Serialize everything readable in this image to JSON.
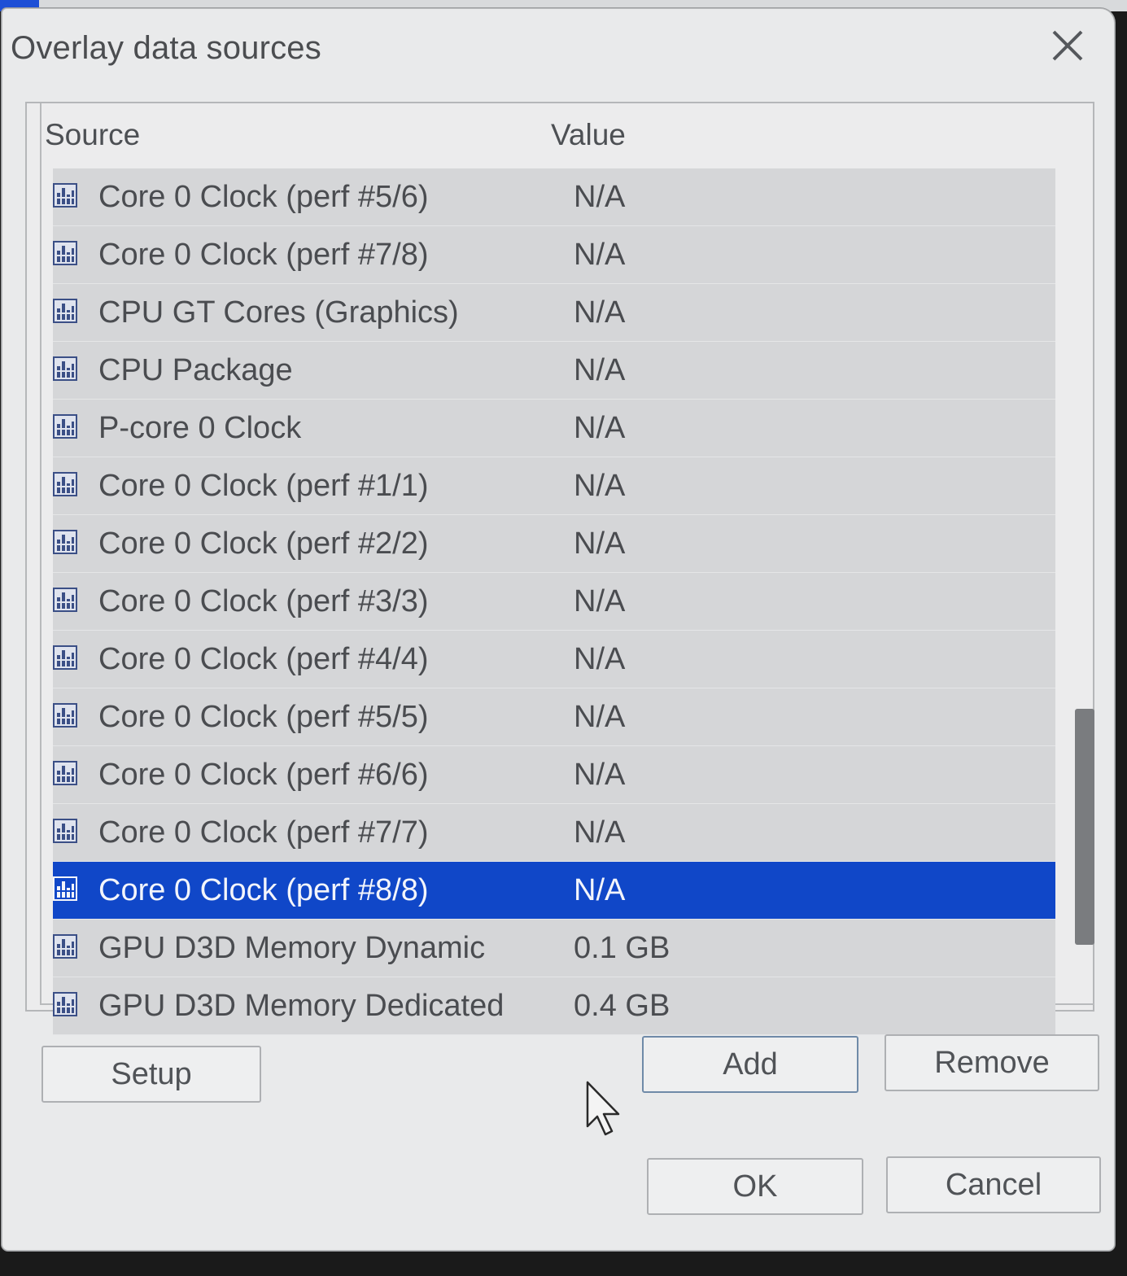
{
  "dialog": {
    "title": "Overlay data sources"
  },
  "list": {
    "columns": {
      "source": "Source",
      "value": "Value"
    },
    "rows": [
      {
        "source": "Core 0 Clock (perf #5/6)",
        "value": "N/A"
      },
      {
        "source": "Core 0 Clock (perf #7/8)",
        "value": "N/A"
      },
      {
        "source": "CPU GT Cores (Graphics)",
        "value": "N/A"
      },
      {
        "source": "CPU Package",
        "value": "N/A"
      },
      {
        "source": "P-core 0 Clock",
        "value": "N/A"
      },
      {
        "source": "Core 0 Clock (perf #1/1)",
        "value": "N/A"
      },
      {
        "source": "Core 0 Clock (perf #2/2)",
        "value": "N/A"
      },
      {
        "source": "Core 0 Clock (perf #3/3)",
        "value": "N/A"
      },
      {
        "source": "Core 0 Clock (perf #4/4)",
        "value": "N/A"
      },
      {
        "source": "Core 0 Clock (perf #5/5)",
        "value": "N/A"
      },
      {
        "source": "Core 0 Clock (perf #6/6)",
        "value": "N/A"
      },
      {
        "source": "Core 0 Clock (perf #7/7)",
        "value": "N/A"
      },
      {
        "source": "Core 0 Clock (perf #8/8)",
        "value": "N/A",
        "selected": true
      },
      {
        "source": "GPU D3D Memory Dynamic",
        "value": "0.1 GB"
      },
      {
        "source": "GPU D3D Memory Dedicated",
        "value": "0.4 GB"
      }
    ],
    "row_icon": "sensor-chart-icon"
  },
  "buttons": {
    "setup": "Setup",
    "add": "Add",
    "remove": "Remove",
    "ok": "OK",
    "cancel": "Cancel"
  },
  "colors": {
    "selection": "#1047c8",
    "row_bg": "#d5d6d8",
    "dialog_bg": "#e9eaeb"
  }
}
